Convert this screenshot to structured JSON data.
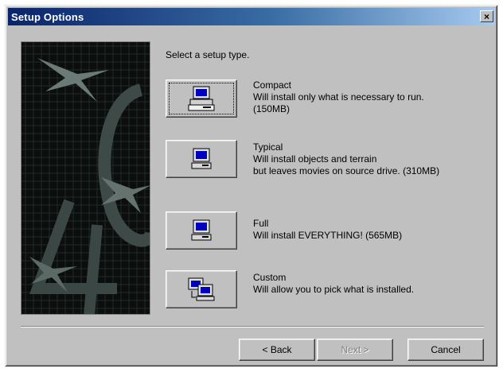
{
  "window": {
    "title": "Setup Options",
    "close_glyph": "×"
  },
  "prompt": "Select a setup type.",
  "options": [
    {
      "name": "Compact",
      "lines": [
        "Will install only what is necessary to run.",
        "(150MB)"
      ],
      "icon": "computer-drive-icon"
    },
    {
      "name": "Typical",
      "lines": [
        "Will install objects and terrain",
        "but leaves movies on source drive. (310MB)"
      ],
      "icon": "computer-icon"
    },
    {
      "name": "Full",
      "lines": [
        "Will install EVERYTHING! (565MB)"
      ],
      "icon": "computer-icon"
    },
    {
      "name": "Custom",
      "lines": [
        "Will allow you to pick what is installed."
      ],
      "icon": "computer-select-icon"
    }
  ],
  "buttons": {
    "back": "< Back",
    "next": "Next >",
    "cancel": "Cancel"
  },
  "colors": {
    "face": "#c0c0c0",
    "title_start": "#0a246a",
    "title_end": "#a6caf0",
    "screen": "#0000c0"
  }
}
